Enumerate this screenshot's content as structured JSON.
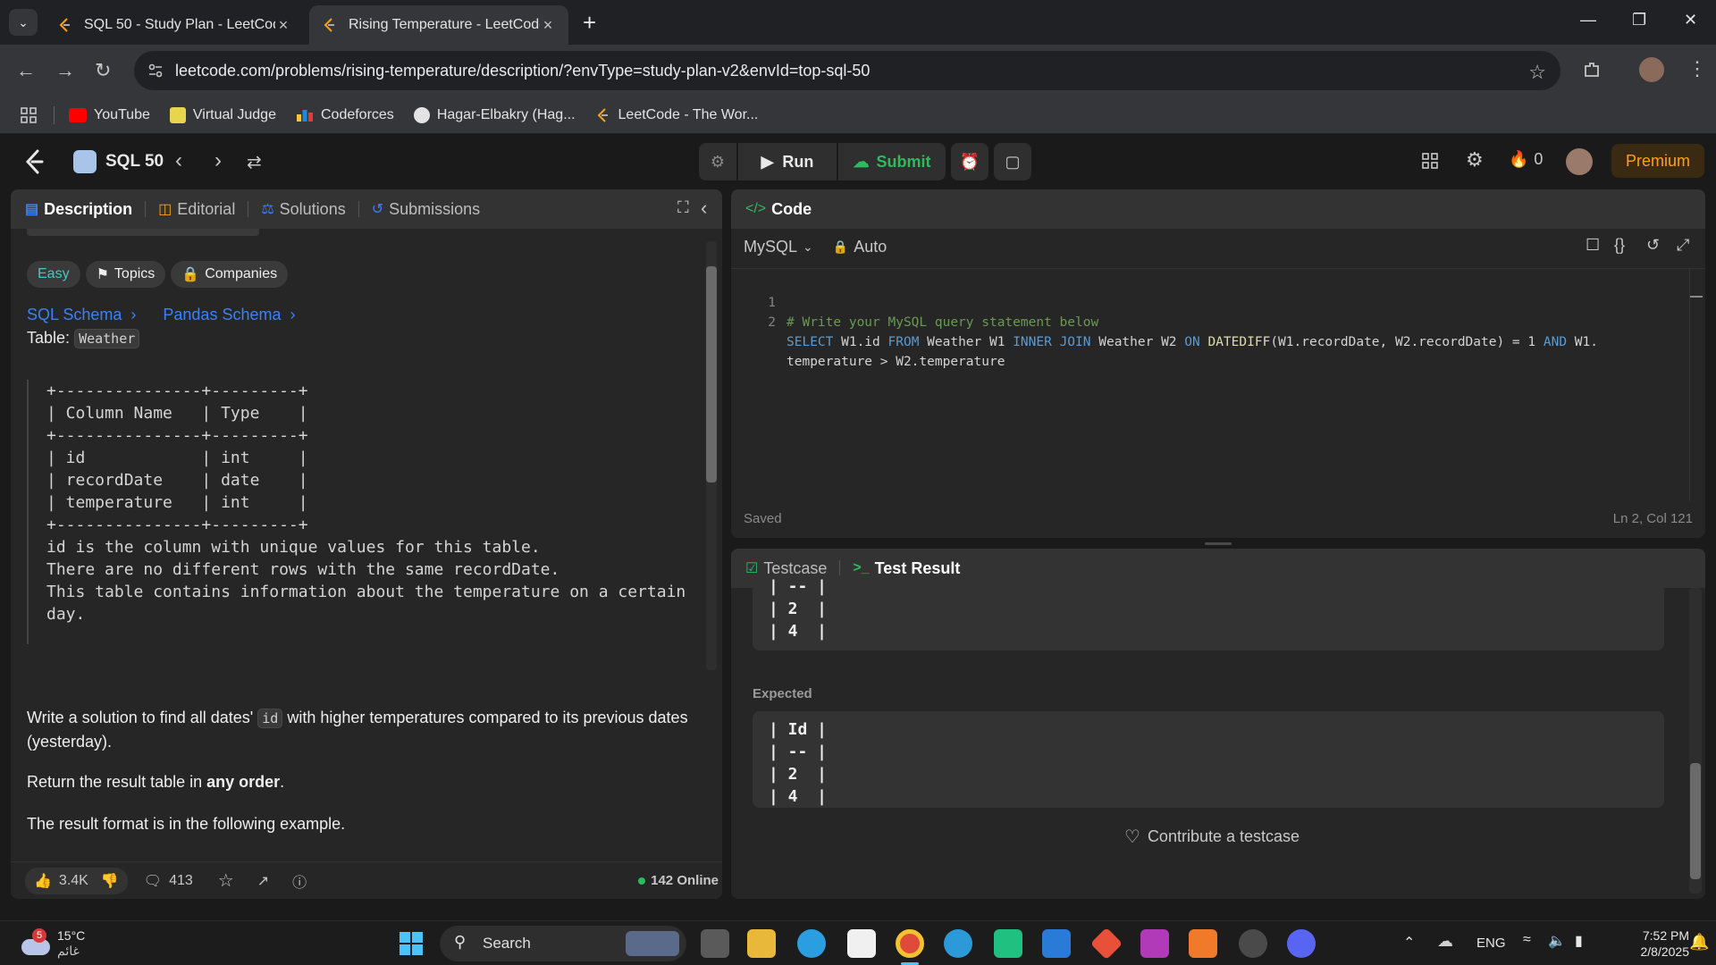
{
  "browser": {
    "tabs": [
      {
        "title": "SQL 50 - Study Plan - LeetCode",
        "active": false
      },
      {
        "title": "Rising Temperature - LeetCode",
        "active": true
      }
    ],
    "url": "leetcode.com/problems/rising-temperature/description/?envType=study-plan-v2&envId=top-sql-50",
    "bookmarks": [
      "YouTube",
      "Virtual Judge",
      "Codeforces",
      "Hagar-Elbakry (Hag...",
      "LeetCode - The Wor..."
    ]
  },
  "header": {
    "study_plan": "SQL 50",
    "run_label": "Run",
    "submit_label": "Submit",
    "streak_count": "0",
    "premium_label": "Premium"
  },
  "description_panel": {
    "tabs": [
      "Description",
      "Editorial",
      "Solutions",
      "Submissions"
    ],
    "difficulty": "Easy",
    "topics_label": "Topics",
    "companies_label": "Companies",
    "sql_schema_link": "SQL Schema",
    "pandas_schema_link": "Pandas Schema",
    "table_label": "Table:",
    "table_name": "Weather",
    "schema_text": "+---------------+---------+\n| Column Name   | Type    |\n+---------------+---------+\n| id            | int     |\n| recordDate    | date    |\n| temperature   | int     |\n+---------------+---------+\nid is the column with unique values for this table.\nThere are no different rows with the same recordDate.\nThis table contains information about the temperature on a certain\nday.",
    "para1_before": "Write a solution to find all dates'",
    "para1_code": "id",
    "para1_after": "with higher temperatures compared to its previous dates (yesterday).",
    "para2_before": "Return the result table in",
    "para2_bold": "any order",
    "para2_after": ".",
    "para3": "The result format is in the following example.",
    "footer": {
      "likes": "3.4K",
      "comments": "413",
      "online": "142 Online"
    }
  },
  "code_panel": {
    "title": "Code",
    "language": "MySQL",
    "mode": "Auto",
    "lines": [
      {
        "num": "1",
        "text": "# Write your MySQL query statement below"
      },
      {
        "num": "2",
        "text": "SELECT W1.id FROM Weather W1 INNER JOIN Weather W2 ON DATEDIFF(W1.recordDate, W2.recordDate) = 1 AND W1."
      },
      {
        "num": "",
        "text": "temperature > W2.temperature"
      }
    ],
    "status": "Saved",
    "cursor": "Ln 2, Col 121"
  },
  "result_panel": {
    "tabs": [
      "Testcase",
      "Test Result"
    ],
    "output_partial": "| -- |\n| 2  |\n| 4  |",
    "expected_label": "Expected",
    "expected_text": "| Id |\n| -- |\n| 2  |\n| 4  |",
    "contribute_label": "Contribute a testcase"
  },
  "taskbar": {
    "weather_temp": "15°C",
    "weather_desc": "غائم",
    "weather_badge": "5",
    "search_label": "Search",
    "language": "ENG",
    "time": "7:52 PM",
    "date": "2/8/2025"
  },
  "colors": {
    "accent_orange": "#ffa116",
    "submit_green": "#2cbb5d",
    "link_blue": "#3b82f6",
    "easy_teal": "#46c6c2"
  }
}
